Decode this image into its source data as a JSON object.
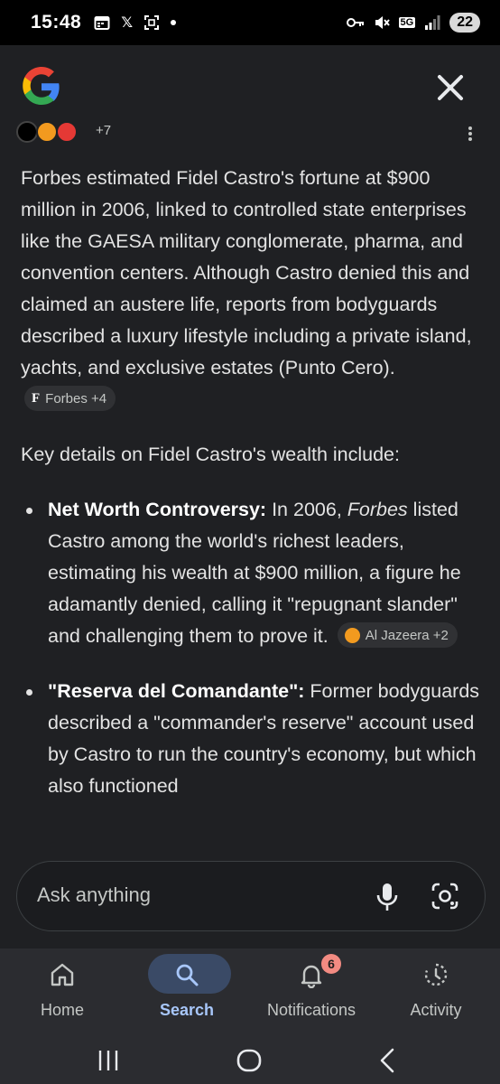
{
  "status_bar": {
    "time": "15:48",
    "network": "5G",
    "battery": "22"
  },
  "header": {
    "logo": "google-g-logo",
    "close_icon": "close-icon"
  },
  "sources": {
    "more": "+7"
  },
  "content": {
    "para1": "Forbes estimated Fidel Castro's fortune at $900 million in 2006, linked to controlled state enterprises like the GAESA military conglomerate, pharma, and convention centers. Although Castro denied this and claimed an austere life, reports from bodyguards described a luxury lifestyle including a private island, yachts, and exclusive estates (Punto Cero).",
    "para1_chip": "Forbes +4",
    "para2": "Key details on Fidel Castro's wealth include:",
    "bullet1_title": "Net Worth Controversy:",
    "bullet1_pre": " In 2006, ",
    "bullet1_italic": "Forbes",
    "bullet1_post": " listed Castro among the world's richest leaders, estimating his wealth at $900 million, a figure he adamantly denied, calling it \"repugnant slander\" and challenging them to prove it.",
    "bullet1_chip": "Al Jazeera +2",
    "bullet2_title": "\"Reserva del Comandante\":",
    "bullet2_text": " Former bodyguards described a \"commander's reserve\" account used by Castro to run the country's economy, but which also functioned"
  },
  "ask": {
    "placeholder": "Ask anything"
  },
  "nav": {
    "home": "Home",
    "search": "Search",
    "notifications": "Notifications",
    "notifications_badge": "6",
    "activity": "Activity"
  },
  "colors": {
    "background": "#1f2023",
    "accent": "#a8c7fa",
    "badge": "#f28b82"
  }
}
